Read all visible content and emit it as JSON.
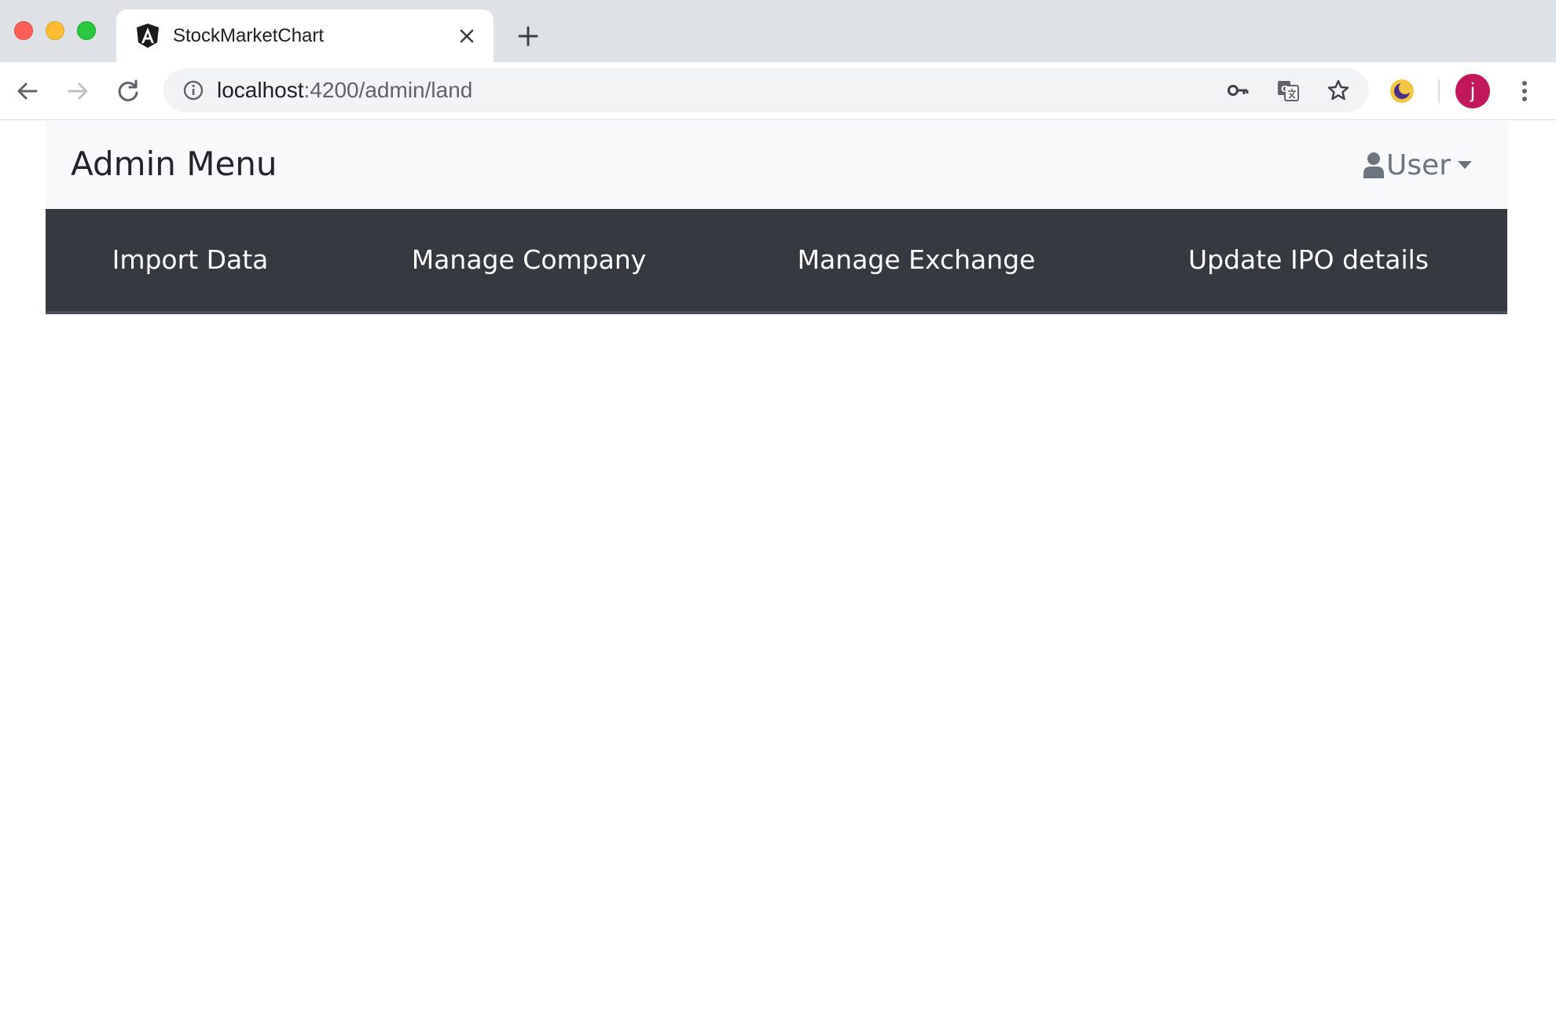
{
  "browser": {
    "tab": {
      "title": "StockMarketChart",
      "favicon": "angular-logo-icon"
    },
    "address_bar": {
      "host": "localhost",
      "path": ":4200/admin/land"
    },
    "profile_initial": "j"
  },
  "app": {
    "brand": "Admin Menu",
    "user_menu_label": "User",
    "menu": [
      {
        "label": "Import Data"
      },
      {
        "label": "Manage Company"
      },
      {
        "label": "Manage Exchange"
      },
      {
        "label": "Update IPO details"
      }
    ]
  },
  "colors": {
    "header_bg": "#f8f9fa",
    "menu_bg": "#343a40",
    "avatar": "#c2185b"
  }
}
